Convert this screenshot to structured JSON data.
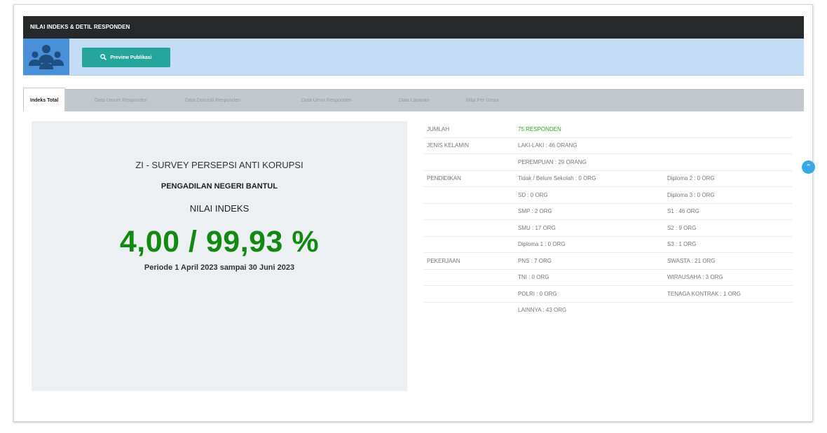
{
  "panel": {
    "title": "NILAI INDEKS & DETIL RESPONDEN"
  },
  "toolbar": {
    "avatar_icon": "users-group-icon",
    "preview_label": "Preview Publikasi",
    "search_icon": "search-icon"
  },
  "tabs": [
    {
      "label": "Indeks Total",
      "active": true
    },
    {
      "label": "Data Umum Responden",
      "active": false
    },
    {
      "label": "Data Domisili Responden",
      "active": false
    },
    {
      "label": "Data Umur Responden",
      "active": false
    },
    {
      "label": "Data Layanan",
      "active": false
    },
    {
      "label": "Nilai Per Unsur",
      "active": false
    }
  ],
  "index": {
    "survey": "ZI - SURVEY PERSEPSI ANTI KORUPSI",
    "organization": "PENGADILAN NEGERI BANTUL",
    "label": "NILAI INDEKS",
    "value": "4,00 / 99,93 %",
    "period": "Periode 1 April 2023 sampai 30 Juni 2023"
  },
  "details": [
    {
      "cat": "JUMLAH",
      "a": "75 RESPONDEN",
      "b": "",
      "highlight": true
    },
    {
      "cat": "JENIS KELAMIN",
      "a": "LAKI-LAKI : 46 ORANG",
      "b": ""
    },
    {
      "cat": "",
      "a": "PEREMPUAN : 29 ORANG",
      "b": ""
    },
    {
      "cat": "PENDIDIKAN",
      "a": "Tidak / Belum Sekolah : 0 ORG",
      "b": "Diploma 2 : 0 ORG"
    },
    {
      "cat": "",
      "a": "SD : 0 ORG",
      "b": "Diploma 3 : 0 ORG"
    },
    {
      "cat": "",
      "a": "SMP : 2 ORG",
      "b": "S1 : 46 ORG"
    },
    {
      "cat": "",
      "a": "SMU : 17 ORG",
      "b": "S2 : 9 ORG"
    },
    {
      "cat": "",
      "a": "Diploma 1 : 0 ORG",
      "b": "S3 : 1 ORG"
    },
    {
      "cat": "PEKERJAAN",
      "a": "PNS : 7 ORG",
      "b": "SWASTA : 21 ORG"
    },
    {
      "cat": "",
      "a": "TNI : 0 ORG",
      "b": "WIRAUSAHA : 3 ORG"
    },
    {
      "cat": "",
      "a": "POLRI : 0 ORG",
      "b": "TENAGA KONTRAK : 1 ORG"
    },
    {
      "cat": "",
      "a": "LAINNYA : 43 ORG",
      "b": ""
    }
  ],
  "scroll_top_icon": "chevron-up-icon",
  "colors": {
    "header": "#27282a",
    "toolbar": "#c5dcf6",
    "button": "#26a69a",
    "value": "#128a12",
    "highlight": "#26a826",
    "tabs_bar": "#c3c8cc"
  }
}
